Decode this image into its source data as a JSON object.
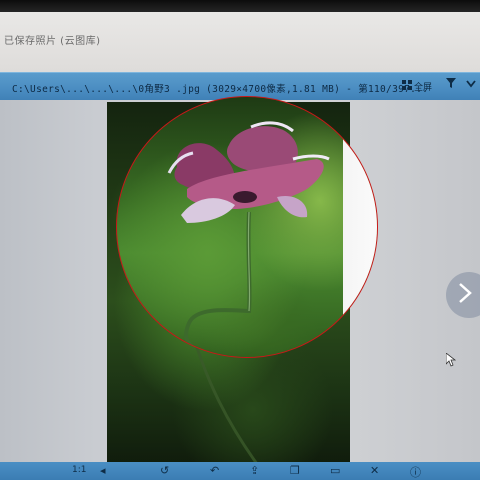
{
  "window": {
    "title": "已保存照片 (云图库)"
  },
  "toolbar": {
    "path": "C:\\Users\\...\\...\\...\\0角野3 .jpg (3029×4700像素,1.81 MB) - 第110/397...",
    "fullscreen_label": "全屏",
    "filter_icon": "funnel-icon",
    "dropdown_icon": "chevron-down-icon",
    "grid_icon": "grid-icon"
  },
  "viewer": {
    "image_subject": "poppy-flower-photo",
    "magnifier_border_color": "#c81818",
    "next_icon": "chevron-right-icon"
  },
  "bottom_bar": {
    "page_num": "1:1"
  }
}
